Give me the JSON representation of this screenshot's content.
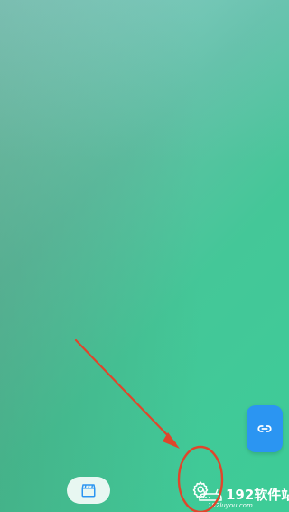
{
  "app": {
    "background_colors": [
      "#8ed3c3",
      "#5fc1a4",
      "#3dcc97"
    ]
  },
  "fab": {
    "icon": "link-icon",
    "color": "#2b95f2"
  },
  "bottom_bar": {
    "media_icon": "clapperboard-icon",
    "settings_icon": "gear-icon"
  },
  "annotation": {
    "arrow_color": "#e0452b",
    "circle_color": "#e0452b"
  },
  "watermark": {
    "title": "192软件站",
    "subtitle": "192luyou.com"
  }
}
